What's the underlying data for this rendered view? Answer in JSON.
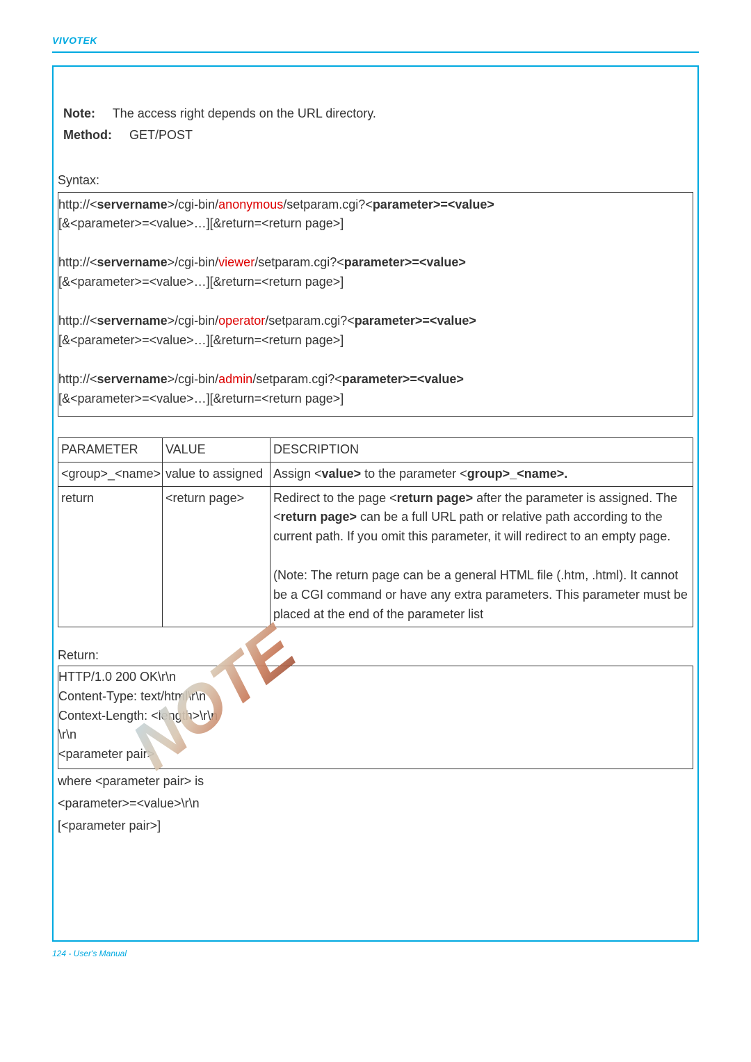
{
  "header": {
    "brand": "VIVOTEK"
  },
  "intro": {
    "note_line1_prefix": "Note:",
    "note_line1": "The access right depends on the URL directory.",
    "method_label": "Method:",
    "method_value": "GET/POST"
  },
  "syntax": {
    "label": "Syntax:",
    "http_prefix": "http://<",
    "servername": "servername",
    "cgi_bin": ">/cgi-bin/",
    "roles": {
      "anonymous": "anonymous",
      "viewer": "viewer",
      "operator": "operator",
      "admin": "admin"
    },
    "setparam": "/setparam.cgi?<",
    "param_eq_val": "parameter>=<value>",
    "continuation": "[&<parameter>=<value>…][&return=<return page>]"
  },
  "param_table": {
    "headers": {
      "param": "PARAMETER",
      "value": "VALUE",
      "desc": "DESCRIPTION"
    },
    "row1": {
      "param": "<group>_<name>",
      "value": "value to assigned",
      "desc_prefix": "Assign <",
      "desc_bold1": "value>",
      "desc_mid": " to the parameter <",
      "desc_bold2": "group>_<name>."
    },
    "row2": {
      "param": "return",
      "value": "<return page>",
      "d1a": "Redirect to the page <",
      "d1b": "return page>",
      "d1c": " after the parameter is assigned. The <",
      "d1d": "return page>",
      "d1e": " can be a full URL path or relative path according to the current path. If you omit this parameter, it will redirect to an empty page.",
      "d2": "(Note: The return page can be a general HTML file (.htm, .html). It cannot be a CGI command or have any extra parameters. This parameter must be placed at the end of the parameter list"
    }
  },
  "return": {
    "label": "Return:",
    "l1": "HTTP/1.0 200 OK\\r\\n",
    "l2": "Content-Type: text/html\\r\\n",
    "l3": "Context-Length: <length>\\r\\n",
    "l4": "\\r\\n",
    "l5": "<parameter pair>",
    "after1": "where <parameter pair> is",
    "after2": "<parameter>=<value>\\r\\n",
    "after3": "[<parameter pair>]"
  },
  "footer": {
    "text": "124 - User's Manual"
  }
}
